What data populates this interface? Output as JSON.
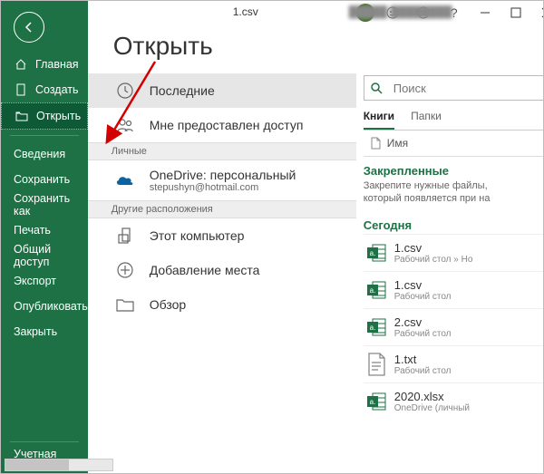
{
  "titlebar": {
    "filename": "1.csv",
    "username": "█████ ████████"
  },
  "page_title": "Открыть",
  "sidebar": {
    "primary": [
      {
        "icon": "home",
        "label": "Главная"
      },
      {
        "icon": "new",
        "label": "Создать"
      },
      {
        "icon": "open",
        "label": "Открыть",
        "selected": true
      }
    ],
    "secondary": [
      {
        "label": "Сведения"
      },
      {
        "label": "Сохранить"
      },
      {
        "label": "Сохранить как"
      },
      {
        "label": "Печать"
      },
      {
        "label": "Общий доступ"
      },
      {
        "label": "Экспорт"
      },
      {
        "label": "Опубликовать"
      },
      {
        "label": "Закрыть"
      }
    ],
    "footer": [
      {
        "label": "Учетная запись"
      }
    ]
  },
  "sources": {
    "items_top": [
      {
        "icon": "clock",
        "label": "Последние",
        "selected": true
      },
      {
        "icon": "shared",
        "label": "Мне предоставлен доступ"
      }
    ],
    "group_personal": "Личные",
    "onedrive": {
      "label": "OneDrive: персональный",
      "sub": "stepushyn@hotmail.com"
    },
    "group_other": "Другие расположения",
    "items_other": [
      {
        "icon": "pc",
        "label": "Этот компьютер"
      },
      {
        "icon": "addplace",
        "label": "Добавление места"
      },
      {
        "icon": "browse",
        "label": "Обзор"
      }
    ]
  },
  "files_panel": {
    "search_placeholder": "Поиск",
    "tabs": [
      {
        "label": "Книги",
        "active": true
      },
      {
        "label": "Папки"
      }
    ],
    "col_name_header": "Имя",
    "pinned_title": "Закрепленные",
    "pinned_desc": "Закрепите нужные файлы, который появляется при на",
    "today_title": "Сегодня",
    "files": [
      {
        "type": "csv",
        "name": "1.csv",
        "loc": "Рабочий стол » Но"
      },
      {
        "type": "csv",
        "name": "1.csv",
        "loc": "Рабочий стол"
      },
      {
        "type": "csv",
        "name": "2.csv",
        "loc": "Рабочий стол"
      },
      {
        "type": "txt",
        "name": "1.txt",
        "loc": "Рабочий стол"
      },
      {
        "type": "xlsx",
        "name": "2020.xlsx",
        "loc": "OneDrive (личный"
      }
    ]
  }
}
